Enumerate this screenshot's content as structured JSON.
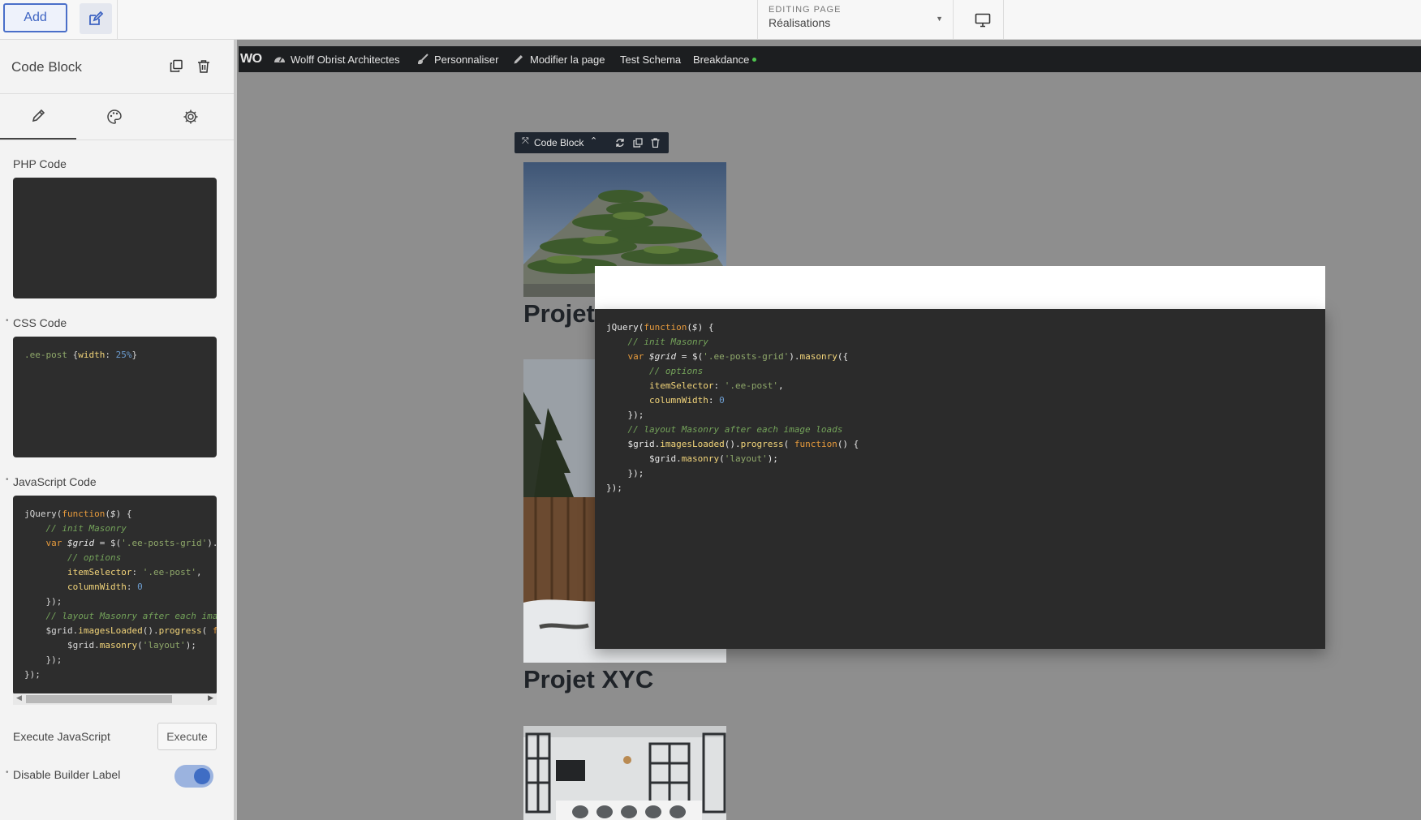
{
  "topbar": {
    "add_label": "Add",
    "editing_label": "EDITING PAGE",
    "editing_value": "Réalisations"
  },
  "panel": {
    "title": "Code Block",
    "php_label": "PHP Code",
    "css_label": "CSS Code",
    "js_label": "JavaScript Code",
    "execute_label": "Execute JavaScript",
    "execute_button": "Execute",
    "disable_label_text": "Disable Builder Label",
    "disable_label_on": true,
    "css_code": [
      {
        "t": ".ee-post ",
        "c": "s"
      },
      {
        "t": "{",
        "c": "d"
      },
      {
        "t": "width",
        "c": "p"
      },
      {
        "t": ": ",
        "c": "d"
      },
      {
        "t": "25%",
        "c": "n"
      },
      {
        "t": "}",
        "c": "d"
      }
    ]
  },
  "adminbar": {
    "logo": "WO",
    "site": "Wolff Obrist Architectes",
    "customize": "Personnaliser",
    "edit_page": "Modifier la page",
    "test_schema": "Test Schema",
    "breakdance": "Breakdance"
  },
  "canvas": {
    "toolbar_label": "Code Block",
    "post_titles": [
      "Projet",
      "Projet XYC"
    ]
  },
  "js_code_lines": [
    [
      {
        "t": "jQuery(",
        "c": "d"
      },
      {
        "t": "function",
        "c": "k"
      },
      {
        "t": "(",
        "c": "d"
      },
      {
        "t": "$",
        "c": "v"
      },
      {
        "t": ") {",
        "c": "d"
      }
    ],
    [
      {
        "t": "    // init Masonry",
        "c": "c"
      }
    ],
    [
      {
        "t": "    ",
        "c": "d"
      },
      {
        "t": "var ",
        "c": "k"
      },
      {
        "t": "$grid",
        "c": "v"
      },
      {
        "t": " = $(",
        "c": "d"
      },
      {
        "t": "'.ee-posts-grid'",
        "c": "s"
      },
      {
        "t": ").",
        "c": "d"
      },
      {
        "t": "masonry",
        "c": "p"
      },
      {
        "t": "({",
        "c": "d"
      }
    ],
    [
      {
        "t": "        // options",
        "c": "c"
      }
    ],
    [
      {
        "t": "        ",
        "c": "d"
      },
      {
        "t": "itemSelector",
        "c": "p"
      },
      {
        "t": ": ",
        "c": "d"
      },
      {
        "t": "'.ee-post'",
        "c": "s"
      },
      {
        "t": ",",
        "c": "d"
      }
    ],
    [
      {
        "t": "        ",
        "c": "d"
      },
      {
        "t": "columnWidth",
        "c": "p"
      },
      {
        "t": ": ",
        "c": "d"
      },
      {
        "t": "0",
        "c": "n"
      }
    ],
    [
      {
        "t": "    });",
        "c": "d"
      }
    ],
    [
      {
        "t": "    // layout Masonry after each image loads",
        "c": "c"
      }
    ],
    [
      {
        "t": "    $grid.",
        "c": "d"
      },
      {
        "t": "imagesLoaded",
        "c": "p"
      },
      {
        "t": "().",
        "c": "d"
      },
      {
        "t": "progress",
        "c": "p"
      },
      {
        "t": "( ",
        "c": "d"
      },
      {
        "t": "function",
        "c": "k"
      },
      {
        "t": "() {",
        "c": "d"
      }
    ],
    [
      {
        "t": "        $grid.",
        "c": "d"
      },
      {
        "t": "masonry",
        "c": "p"
      },
      {
        "t": "(",
        "c": "d"
      },
      {
        "t": "'layout'",
        "c": "s"
      },
      {
        "t": ");",
        "c": "d"
      }
    ],
    [
      {
        "t": "    });",
        "c": "d"
      }
    ],
    [
      {
        "t": "});",
        "c": "d"
      }
    ]
  ]
}
